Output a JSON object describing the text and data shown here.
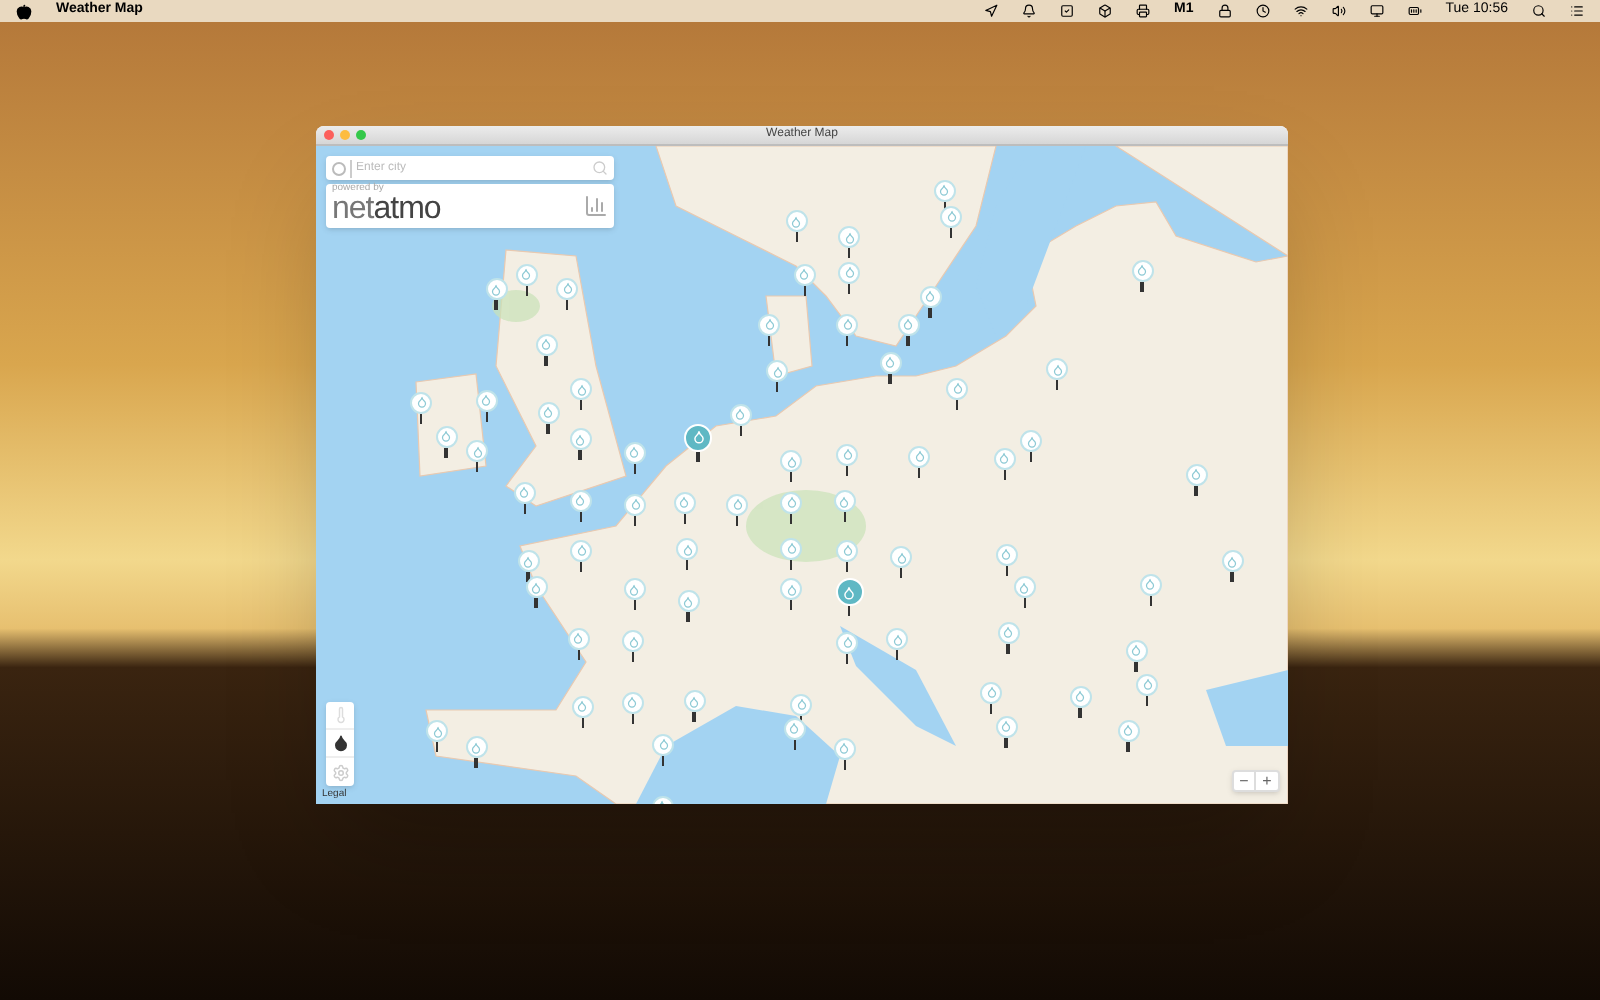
{
  "menu_bar": {
    "app_name": "Weather Map",
    "status_label": "M1",
    "clock": "Tue 10:56"
  },
  "window": {
    "title": "Weather Map"
  },
  "search": {
    "placeholder": "Enter city"
  },
  "branding": {
    "powered_by": "powered by",
    "logo_light": "net",
    "logo_bold": "atmo"
  },
  "layers": [
    {
      "kind": "temperature",
      "selected": false
    },
    {
      "kind": "rain",
      "selected": true
    }
  ],
  "legal": "Legal",
  "zoom": {
    "out": "−",
    "in": "+"
  },
  "pins": [
    {
      "selected": false
    },
    {
      "selected": false
    },
    {
      "selected": false
    },
    {
      "selected": false
    },
    {
      "selected": false
    },
    {
      "selected": false
    },
    {
      "selected": false
    },
    {
      "selected": false
    },
    {
      "selected": false
    },
    {
      "selected": false
    },
    {
      "selected": false
    },
    {
      "selected": false
    },
    {
      "selected": false
    },
    {
      "selected": false
    },
    {
      "selected": false
    },
    {
      "selected": false
    },
    {
      "selected": false
    },
    {
      "selected": false
    },
    {
      "selected": false
    },
    {
      "selected": true
    },
    {
      "selected": false
    },
    {
      "selected": false
    },
    {
      "selected": false
    },
    {
      "selected": false
    },
    {
      "selected": false
    },
    {
      "selected": false
    },
    {
      "selected": false
    },
    {
      "selected": false
    },
    {
      "selected": false
    },
    {
      "selected": false
    },
    {
      "selected": false
    },
    {
      "selected": false
    },
    {
      "selected": false
    },
    {
      "selected": false
    },
    {
      "selected": false
    },
    {
      "selected": false
    },
    {
      "selected": false
    },
    {
      "selected": false
    },
    {
      "selected": false
    },
    {
      "selected": false
    },
    {
      "selected": false
    },
    {
      "selected": false
    },
    {
      "selected": false
    },
    {
      "selected": false
    },
    {
      "selected": false
    },
    {
      "selected": false
    },
    {
      "selected": false
    },
    {
      "selected": false
    },
    {
      "selected": false
    },
    {
      "selected": false
    },
    {
      "selected": false
    },
    {
      "selected": false
    },
    {
      "selected": true
    },
    {
      "selected": false
    },
    {
      "selected": false
    },
    {
      "selected": false
    },
    {
      "selected": false
    },
    {
      "selected": false
    },
    {
      "selected": false
    },
    {
      "selected": false
    },
    {
      "selected": false
    },
    {
      "selected": false
    },
    {
      "selected": false
    },
    {
      "selected": false
    },
    {
      "selected": false
    },
    {
      "selected": false
    },
    {
      "selected": false
    },
    {
      "selected": false
    },
    {
      "selected": false
    },
    {
      "selected": false
    },
    {
      "selected": false
    },
    {
      "selected": false
    },
    {
      "selected": false
    },
    {
      "selected": false
    },
    {
      "selected": false
    },
    {
      "selected": false
    },
    {
      "selected": false
    },
    {
      "selected": false
    }
  ]
}
